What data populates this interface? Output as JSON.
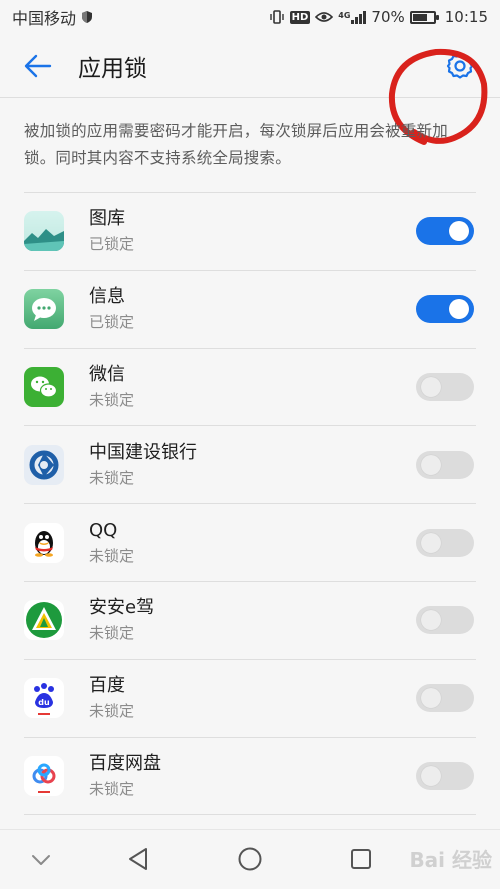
{
  "status_bar": {
    "carrier": "中国移动",
    "hd_badge": "HD",
    "network": "4G",
    "battery_percent": "70%",
    "battery_level": 0.7,
    "time": "10:15"
  },
  "header": {
    "title": "应用锁",
    "back_icon": "back-arrow-icon",
    "settings_icon": "gear-icon",
    "accent_color": "#1a73e8"
  },
  "description": "被加锁的应用需要密码才能开启，每次锁屏后应用会被重新加锁。同时其内容不支持系统全局搜索。",
  "apps": [
    {
      "name": "图库",
      "status": "已锁定",
      "locked": true,
      "icon": "gallery-icon"
    },
    {
      "name": "信息",
      "status": "已锁定",
      "locked": true,
      "icon": "messages-icon"
    },
    {
      "name": "微信",
      "status": "未锁定",
      "locked": false,
      "icon": "wechat-icon"
    },
    {
      "name": "中国建设银行",
      "status": "未锁定",
      "locked": false,
      "icon": "ccb-icon"
    },
    {
      "name": "QQ",
      "status": "未锁定",
      "locked": false,
      "icon": "qq-icon"
    },
    {
      "name": "安安e驾",
      "status": "未锁定",
      "locked": false,
      "icon": "anan-edrive-icon"
    },
    {
      "name": "百度",
      "status": "未锁定",
      "locked": false,
      "icon": "baidu-icon"
    },
    {
      "name": "百度网盘",
      "status": "未锁定",
      "locked": false,
      "icon": "baidu-netdisk-icon"
    }
  ],
  "nav_bar": {
    "back_icon": "triangle-back-icon",
    "home_icon": "circle-home-icon",
    "recents_icon": "square-recents-icon",
    "collapse_icon": "chevron-down-icon"
  },
  "watermark": "Bai 经验"
}
